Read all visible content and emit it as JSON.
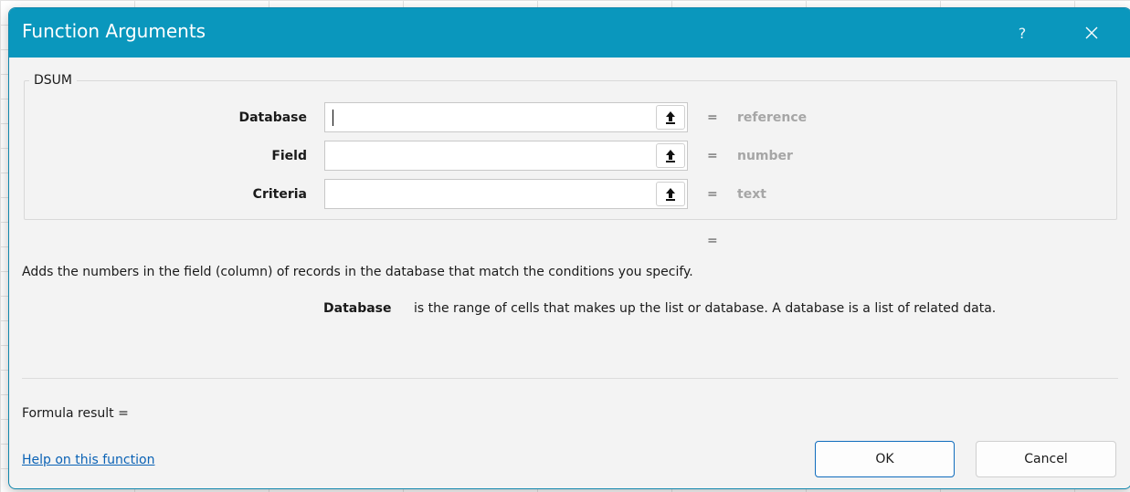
{
  "dialog": {
    "title": "Function Arguments",
    "help_glyph": "?",
    "close_icon": "close-icon"
  },
  "function_group": {
    "name": "DSUM",
    "arguments": [
      {
        "label": "Database",
        "value": "",
        "equals": "=",
        "hint": "reference"
      },
      {
        "label": "Field",
        "value": "",
        "equals": "=",
        "hint": "number"
      },
      {
        "label": "Criteria",
        "value": "",
        "equals": "=",
        "hint": "text"
      }
    ],
    "collapse_icon": "collapse-arrow-icon"
  },
  "result_equals": "=",
  "description": "Adds the numbers in the field (column) of records in the database that match the conditions you specify.",
  "argument_help": {
    "name": "Database",
    "text": "is the range of cells that makes up the list or database. A database is a list of related data."
  },
  "formula_result": "Formula result =",
  "help_link": "Help on this function",
  "buttons": {
    "ok": "OK",
    "cancel": "Cancel"
  },
  "colors": {
    "titlebar": "#0a97bd",
    "link": "#0a62b5",
    "hint": "#a6a6a6"
  }
}
